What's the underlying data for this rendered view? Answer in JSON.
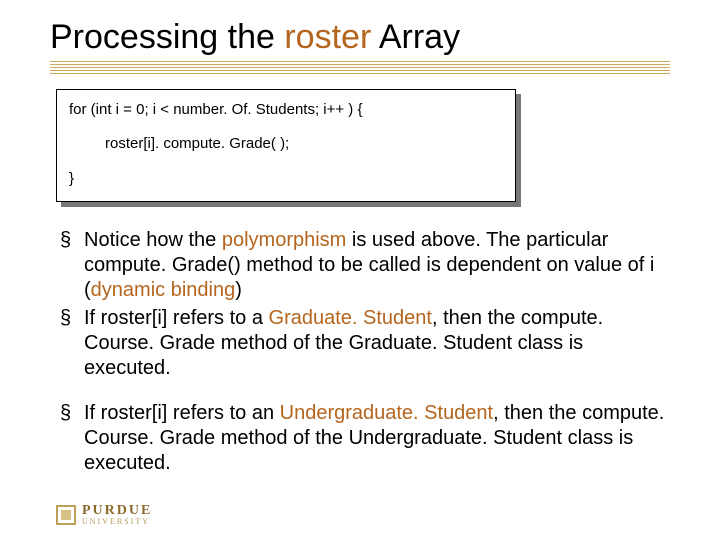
{
  "title": {
    "pre": "Processing the ",
    "accent": "roster",
    "post": " Array"
  },
  "code": {
    "line1": "for (int i = 0; i < number. Of. Students; i++ ) {",
    "line2": "roster[i]. compute. Grade( );",
    "line3": "}"
  },
  "bullets": [
    {
      "runs": [
        {
          "t": "Notice how the "
        },
        {
          "t": "polymorphism",
          "kw": true
        },
        {
          "t": " is used above. The particular compute. Grade() method to be called is dependent on value of i ("
        },
        {
          "t": "dynamic binding",
          "kw": true
        },
        {
          "t": ")"
        }
      ]
    },
    {
      "runs": [
        {
          "t": "If roster[i] refers to a "
        },
        {
          "t": "Graduate. Student",
          "kw": true
        },
        {
          "t": ", then the compute. Course. Grade method of the Graduate. Student class is executed."
        }
      ]
    },
    {
      "gap": true,
      "runs": [
        {
          "t": "If roster[i] refers to an "
        },
        {
          "t": "Undergraduate. Student",
          "kw": true
        },
        {
          "t": ", then the compute. Course. Grade method of the Undergraduate. Student class is executed."
        }
      ]
    }
  ],
  "logo": {
    "main": "PURDUE",
    "sub": "UNIVERSITY"
  }
}
